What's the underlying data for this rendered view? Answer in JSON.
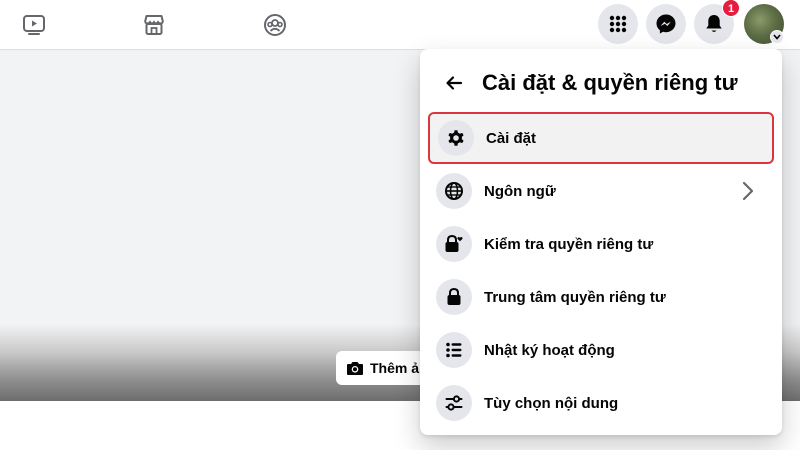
{
  "topbar": {
    "nav_icons": [
      {
        "icon": "video-play-icon"
      },
      {
        "icon": "marketplace-store-icon"
      },
      {
        "icon": "groups-icon"
      }
    ],
    "buttons": [
      {
        "icon": "menu-grid-icon"
      },
      {
        "icon": "messenger-icon"
      },
      {
        "icon": "notification-bell-icon",
        "badge": "1"
      }
    ],
    "avatar": {
      "icon": "avatar"
    }
  },
  "cover": {
    "add_button_label": "Thêm ả"
  },
  "panel": {
    "title": "Cài đặt & quyền riêng tư",
    "items": [
      {
        "label": "Cài đặt",
        "icon": "gear-icon",
        "highlighted": true
      },
      {
        "label": "Ngôn ngữ",
        "icon": "globe-icon",
        "has_chevron": true
      },
      {
        "label": "Kiểm tra quyền riêng tư",
        "icon": "lock-heart-icon"
      },
      {
        "label": "Trung tâm quyền riêng tư",
        "icon": "lock-icon"
      },
      {
        "label": "Nhật ký hoạt động",
        "icon": "list-icon"
      },
      {
        "label": "Tùy chọn nội dung",
        "icon": "sliders-icon"
      }
    ]
  },
  "colors": {
    "highlight_border": "#d9363e",
    "badge": "#e41e3f",
    "icon_bg": "#e4e6eb"
  }
}
